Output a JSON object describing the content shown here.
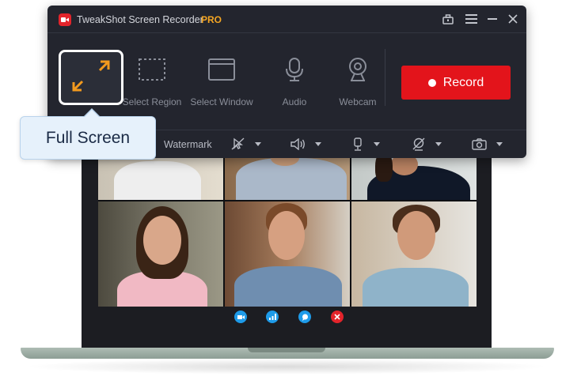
{
  "app": {
    "title": "TweakShot Screen Recorder",
    "badge": "PRO",
    "brand_color": "#e3141b",
    "pro_color": "#f5a623"
  },
  "window_controls": [
    "toolbox-icon",
    "menu-icon",
    "minimize-icon",
    "close-icon"
  ],
  "modes": [
    {
      "id": "full-screen",
      "label": "Full Screen",
      "icon": "fullscreen-icon",
      "selected": true
    },
    {
      "id": "select-region",
      "label": "Select Region",
      "icon": "region-icon"
    },
    {
      "id": "select-window",
      "label": "Select Window",
      "icon": "window-icon"
    },
    {
      "id": "audio",
      "label": "Audio",
      "icon": "microphone-icon"
    },
    {
      "id": "webcam",
      "label": "Webcam",
      "icon": "webcam-icon"
    }
  ],
  "record_button": {
    "label": "Record"
  },
  "options": {
    "watermark_label": "Watermark",
    "items": [
      "cursor-icon",
      "speaker-icon",
      "microphone-icon",
      "webcam-off-icon",
      "camera-icon"
    ]
  },
  "tooltip": {
    "text": "Full Screen"
  },
  "video_call": {
    "participants": 6,
    "controls": [
      {
        "icon": "video-icon",
        "color": "#1e9be9"
      },
      {
        "icon": "signal-icon",
        "color": "#1e9be9"
      },
      {
        "icon": "chat-icon",
        "color": "#1e9be9"
      },
      {
        "icon": "end-call-icon",
        "color": "#e3242b"
      }
    ]
  }
}
